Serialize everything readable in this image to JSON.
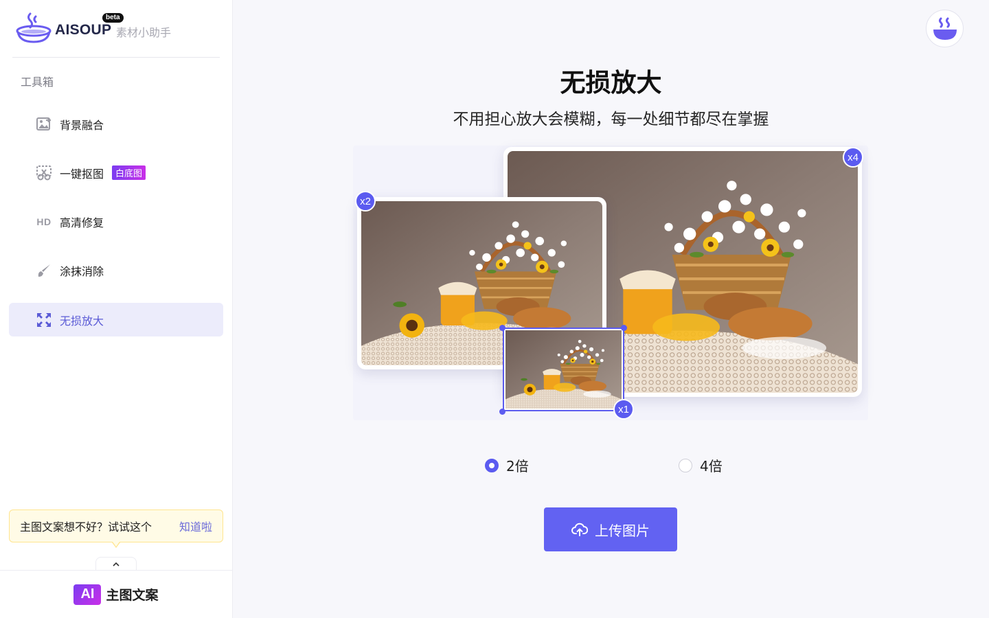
{
  "brand": {
    "name": "AISOUP",
    "beta": "beta",
    "subtitle": "素材小助手"
  },
  "sidebar": {
    "section_title": "工具箱",
    "items": [
      {
        "label": "背景融合",
        "icon": "image-edit-icon"
      },
      {
        "label": "一键抠图",
        "icon": "cutout-icon",
        "badge": "白底图"
      },
      {
        "label": "高清修复",
        "icon": "hd-icon",
        "icon_text": "HD"
      },
      {
        "label": "涂抹消除",
        "icon": "brush-icon"
      },
      {
        "label": "无损放大",
        "icon": "expand-icon",
        "active": true
      }
    ],
    "tip": {
      "text": "主图文案想不好？试试这个",
      "link": "知道啦"
    },
    "bottom": {
      "badge": "AI",
      "label": "主图文案"
    }
  },
  "main": {
    "title": "无损放大",
    "subtitle": "不用担心放大会模糊，每一处细节都尽在掌握",
    "demo": {
      "tags": {
        "x1": "x1",
        "x2": "x2",
        "x4": "x4"
      }
    },
    "options": [
      {
        "label": "2倍",
        "checked": true
      },
      {
        "label": "4倍",
        "checked": false
      }
    ],
    "upload_label": "上传图片"
  },
  "colors": {
    "accent": "#5b5bf0",
    "active_bg": "#ececfb",
    "tip_bg": "#fffbe6",
    "badge_gradient": [
      "#7b3df0",
      "#c92fe8"
    ]
  }
}
